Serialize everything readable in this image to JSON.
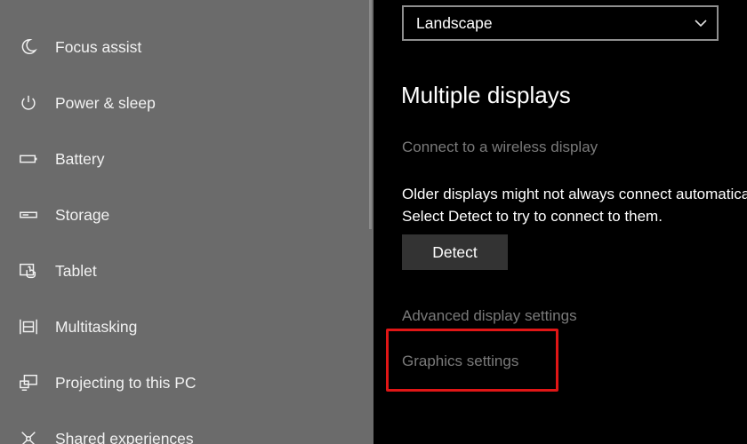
{
  "sidebar": {
    "items": [
      {
        "label": "Focus assist",
        "icon": "moon-icon"
      },
      {
        "label": "Power & sleep",
        "icon": "power-icon"
      },
      {
        "label": "Battery",
        "icon": "battery-icon"
      },
      {
        "label": "Storage",
        "icon": "storage-icon"
      },
      {
        "label": "Tablet",
        "icon": "tablet-icon"
      },
      {
        "label": "Multitasking",
        "icon": "multitasking-icon"
      },
      {
        "label": "Projecting to this PC",
        "icon": "projecting-icon"
      },
      {
        "label": "Shared experiences",
        "icon": "shared-experiences-icon"
      }
    ]
  },
  "content": {
    "orientation": {
      "value": "Landscape"
    },
    "multiple_displays": {
      "title": "Multiple displays",
      "wireless_link": "Connect to a wireless display",
      "description": "Older displays might not always connect automatically. Select Detect to try to connect to them.",
      "detect_label": "Detect",
      "advanced_link": "Advanced display settings",
      "graphics_link": "Graphics settings"
    }
  },
  "colors": {
    "sidebar_bg": "#6b6b6b",
    "content_bg": "#000000",
    "highlight": "#e01616",
    "disabled_text": "#7a7a7a"
  }
}
